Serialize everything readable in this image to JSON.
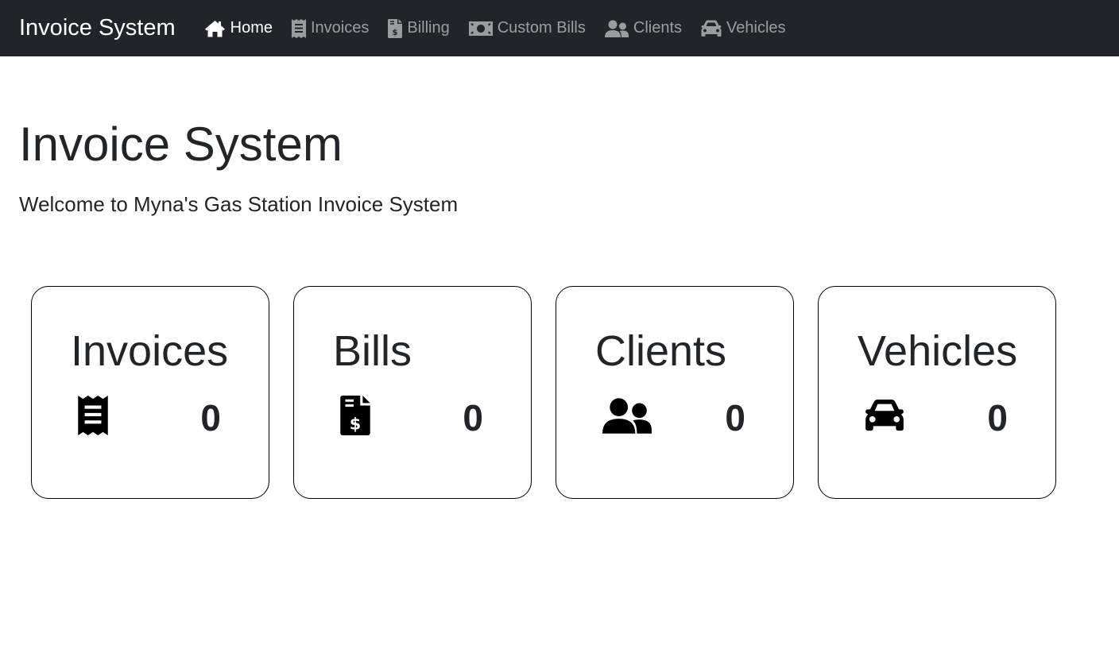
{
  "app": {
    "brand": "Invoice System"
  },
  "nav": {
    "items": [
      {
        "label": "Home",
        "icon": "home-icon",
        "active": true
      },
      {
        "label": "Invoices",
        "icon": "receipt-icon",
        "active": false
      },
      {
        "label": "Billing",
        "icon": "file-invoice-dollar-icon",
        "active": false
      },
      {
        "label": "Custom Bills",
        "icon": "money-bill-icon",
        "active": false
      },
      {
        "label": "Clients",
        "icon": "user-friends-icon",
        "active": false
      },
      {
        "label": "Vehicles",
        "icon": "car-icon",
        "active": false
      }
    ]
  },
  "main": {
    "title": "Invoice System",
    "lead": "Welcome to Myna's Gas Station Invoice System"
  },
  "cards": [
    {
      "title": "Invoices",
      "icon": "receipt-icon",
      "count": "0"
    },
    {
      "title": "Bills",
      "icon": "file-invoice-dollar-icon",
      "count": "0"
    },
    {
      "title": "Clients",
      "icon": "user-friends-icon",
      "count": "0"
    },
    {
      "title": "Vehicles",
      "icon": "car-icon",
      "count": "0"
    }
  ],
  "colors": {
    "navbar_bg": "#212529",
    "text": "#212529",
    "nav_link_inactive": "rgba(255,255,255,0.55)",
    "nav_link_active": "#ffffff"
  }
}
